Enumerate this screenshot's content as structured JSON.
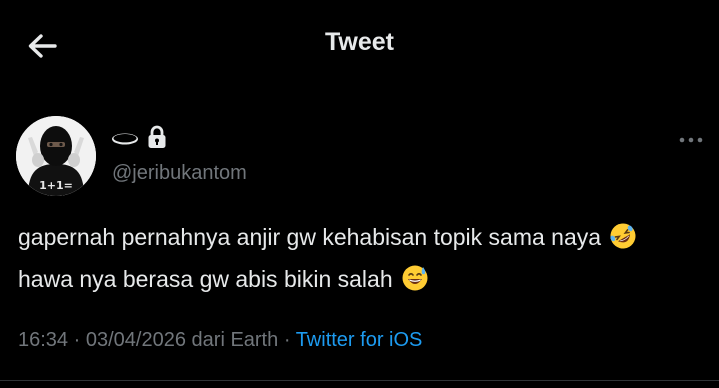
{
  "header": {
    "title": "Tweet",
    "back_icon": "arrow-left-icon"
  },
  "author": {
    "display_name": "",
    "display_name_icon": "hole-emoji",
    "protected_icon": "lock-icon",
    "handle": "@jeribukantom",
    "avatar_text": "1+1="
  },
  "tweet": {
    "text_part1": "gapernah pernahnya anjir gw kehabisan topik sama naya",
    "emoji1": "rolling-on-floor-laughing-emoji",
    "text_part2": "hawa nya berasa gw abis bikin salah",
    "emoji2": "grinning-sweat-emoji"
  },
  "meta": {
    "time": "16:34",
    "separator1": "·",
    "date": "03/04/2026",
    "origin": "dari Earth",
    "separator2": "·",
    "source": "Twitter for iOS"
  },
  "colors": {
    "background": "#000000",
    "text_primary": "#e7e9ea",
    "text_secondary": "#71767b",
    "link": "#1d9bf0"
  }
}
